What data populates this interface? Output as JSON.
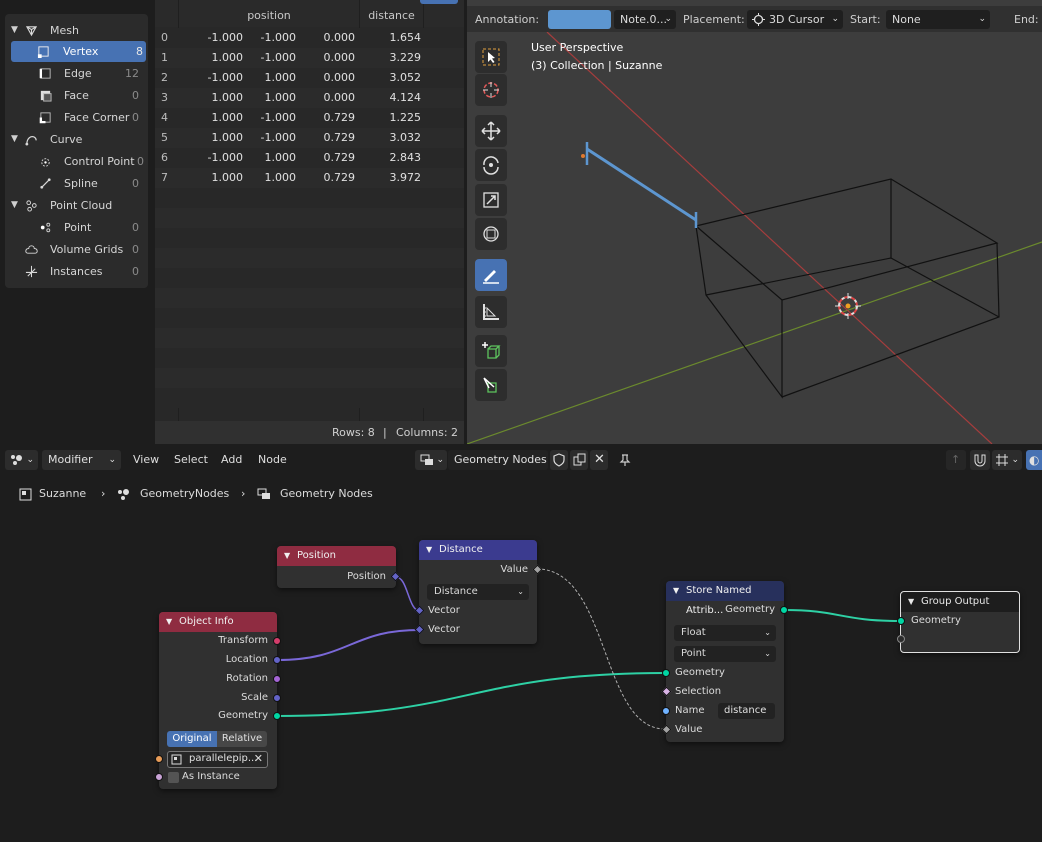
{
  "spreadsheet": {
    "tree": [
      {
        "label": "Mesh",
        "count": "",
        "level": 0
      },
      {
        "label": "Vertex",
        "count": "8",
        "level": 1,
        "selected": true
      },
      {
        "label": "Edge",
        "count": "12",
        "level": 1
      },
      {
        "label": "Face",
        "count": "0",
        "level": 1
      },
      {
        "label": "Face Corner",
        "count": "0",
        "level": 1
      },
      {
        "label": "Curve",
        "count": "",
        "level": 0
      },
      {
        "label": "Control Point",
        "count": "0",
        "level": 1
      },
      {
        "label": "Spline",
        "count": "0",
        "level": 1
      },
      {
        "label": "Point Cloud",
        "count": "",
        "level": 0
      },
      {
        "label": "Point",
        "count": "0",
        "level": 1
      },
      {
        "label": "Volume Grids",
        "count": "0",
        "level": 0
      },
      {
        "label": "Instances",
        "count": "0",
        "level": 0
      }
    ],
    "columns": [
      "position",
      "distance"
    ],
    "rows": [
      [
        "0",
        "-1.000",
        "-1.000",
        "0.000",
        "1.654"
      ],
      [
        "1",
        "1.000",
        "-1.000",
        "0.000",
        "3.229"
      ],
      [
        "2",
        "-1.000",
        "1.000",
        "0.000",
        "3.052"
      ],
      [
        "3",
        "1.000",
        "1.000",
        "0.000",
        "4.124"
      ],
      [
        "4",
        "1.000",
        "-1.000",
        "0.729",
        "1.225"
      ],
      [
        "5",
        "1.000",
        "-1.000",
        "0.729",
        "3.032"
      ],
      [
        "6",
        "-1.000",
        "1.000",
        "0.729",
        "2.843"
      ],
      [
        "7",
        "1.000",
        "1.000",
        "0.729",
        "3.972"
      ]
    ],
    "footer": {
      "rows": "Rows: 8",
      "sep": "|",
      "columns": "Columns: 2"
    }
  },
  "viewport": {
    "header": {
      "annotation_label": "Annotation:",
      "annotation_color": "#5d96d0",
      "note_value": "Note.0...",
      "placement_label": "Placement:",
      "placement_value": "3D Cursor",
      "start_label": "Start:",
      "start_value": "None",
      "end_label": "End:"
    },
    "overlay": {
      "line1": "User Perspective",
      "line2": "(3) Collection | Suzanne"
    },
    "annotation_stroke_color": "#5d96d0"
  },
  "node_editor": {
    "header": {
      "modifier_label": "Modifier",
      "menu": [
        "View",
        "Select",
        "Add",
        "Node"
      ],
      "tree_name": "Geometry Nodes"
    },
    "breadcrumb": [
      "Suzanne",
      "GeometryNodes",
      "Geometry Nodes"
    ],
    "nodes": {
      "position": {
        "title": "Position",
        "outputs": [
          "Position"
        ],
        "color": "#8f2c41"
      },
      "distance": {
        "title": "Distance",
        "output": "Value",
        "mode": "Distance",
        "inputs": [
          "Vector",
          "Vector"
        ],
        "color": "#3b3b8f"
      },
      "object_info": {
        "title": "Object Info",
        "color": "#8f2c41",
        "outputs": [
          "Transform",
          "Location",
          "Rotation",
          "Scale",
          "Geometry"
        ],
        "mode_original": "Original",
        "mode_relative": "Relative",
        "object": "parallelepip...",
        "as_instance": "As Instance"
      },
      "store": {
        "title": "Store Named Attrib...",
        "color": "#27305c",
        "output": "Geometry",
        "type": "Float",
        "domain": "Point",
        "inputs": [
          "Geometry",
          "Selection",
          "Name",
          "Value"
        ],
        "name_value": "distance"
      },
      "group_output": {
        "title": "Group Output",
        "input": "Geometry"
      }
    },
    "colors": {
      "geometry_socket": "#00d6a3",
      "vector_socket": "#6363c7",
      "float_socket": "#a1a1a1",
      "link_geometry": "#2ed1a5",
      "link_vector": "#7a68d8"
    }
  }
}
